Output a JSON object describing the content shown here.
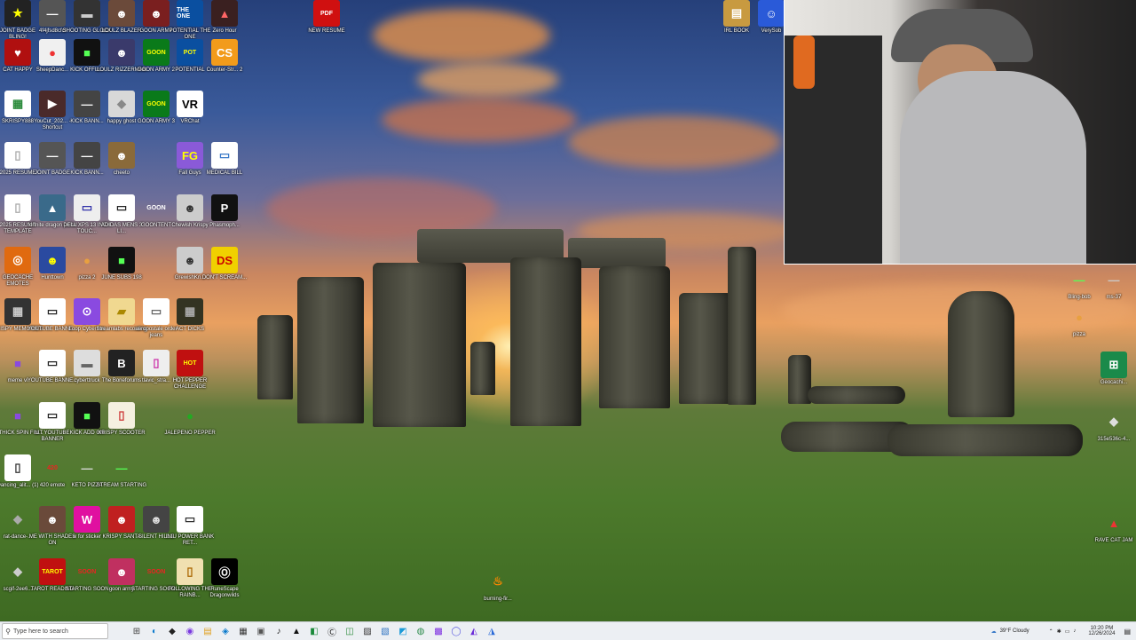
{
  "desktop_icons": [
    {
      "label": "JOINT BADGE BLING!",
      "glyph": "★",
      "bg": "#222",
      "fg": "#ff0"
    },
    {
      "label": "4f4jfsd8cfcl",
      "glyph": "—",
      "bg": "#555",
      "fg": "#fff"
    },
    {
      "label": "SHOOTING GLOCK",
      "glyph": "▬",
      "bg": "#333",
      "fg": "#ccc"
    },
    {
      "label": "LOULZ BLAZER",
      "glyph": "☻",
      "bg": "#6b4a3a",
      "fg": "#fff"
    },
    {
      "label": "GOON ARMY",
      "glyph": "☻",
      "bg": "#7a1f1f",
      "fg": "#fff"
    },
    {
      "label": "POTENTIAL THE ONE",
      "glyph": "THE ONE",
      "bg": "#0a4fa0",
      "fg": "#fff"
    },
    {
      "label": "Zero Hour",
      "glyph": "▲",
      "bg": "#3a2020",
      "fg": "#f66"
    },
    {
      "label": "CAT HAPPY",
      "glyph": "♥",
      "bg": "#b01010",
      "fg": "#fff"
    },
    {
      "label": "SheepDanc...",
      "glyph": "●",
      "bg": "#f0f0f0",
      "fg": "#e33"
    },
    {
      "label": "KICK OFFLI...",
      "glyph": "■",
      "bg": "#111",
      "fg": "#5f5"
    },
    {
      "label": "LOULZ RIZZERMAN",
      "glyph": "☻",
      "bg": "#3a3a6b",
      "fg": "#fff"
    },
    {
      "label": "GOON ARMY 2",
      "glyph": "GOON",
      "bg": "#0a7a1a",
      "fg": "#ff0"
    },
    {
      "label": "POTENTIAL",
      "glyph": "POT",
      "bg": "#0a4fa0",
      "fg": "#ff0"
    },
    {
      "label": "Counter-Str... 2",
      "glyph": "CS",
      "bg": "#f29b1b",
      "fg": "#fff"
    },
    {
      "label": "SKRISPY888",
      "glyph": "▦",
      "bg": "#fff",
      "fg": "#2a8a3a"
    },
    {
      "label": "YouCut_202... - Shortcut",
      "glyph": "▶",
      "bg": "#4a2a2a",
      "fg": "#fff"
    },
    {
      "label": "KICK BANN...",
      "glyph": "—",
      "bg": "#444",
      "fg": "#fff"
    },
    {
      "label": "happy ghost",
      "glyph": "◆",
      "bg": "#d8d8d8",
      "fg": "#888"
    },
    {
      "label": "GOON ARMY 3",
      "glyph": "GOON",
      "bg": "#0a7a1a",
      "fg": "#ff0"
    },
    {
      "label": "VRChat",
      "glyph": "VR",
      "bg": "#fff",
      "fg": "#000"
    },
    {
      "label": "2025 RESUME",
      "glyph": "▯",
      "bg": "#fff",
      "fg": "#aaa"
    },
    {
      "label": "JOINT BADGE",
      "glyph": "—",
      "bg": "#555",
      "fg": "#fff"
    },
    {
      "label": "KICK BANN...",
      "glyph": "—",
      "bg": "#444",
      "fg": "#fff"
    },
    {
      "label": "cheeto",
      "glyph": "☻",
      "bg": "#8a6a3a",
      "fg": "#fff"
    },
    {
      "label": "Fall Guys",
      "glyph": "FG",
      "bg": "#8a5ad8",
      "fg": "#ff0"
    },
    {
      "label": "MEDICAL BILL",
      "glyph": "▭",
      "bg": "#fff",
      "fg": "#3a7ac8"
    },
    {
      "label": "2025 RESUME TEMPLATE",
      "glyph": "▯",
      "bg": "#fff",
      "fg": "#aaa"
    },
    {
      "label": "fortnite dragon portal",
      "glyph": "▲",
      "bg": "#3a6a8a",
      "fg": "#fff"
    },
    {
      "label": "DELL XPS 13 INCH TOUC...",
      "glyph": "▭",
      "bg": "#eee",
      "fg": "#33a"
    },
    {
      "label": "ADIDAS MENS 3 LI...",
      "glyph": "▭",
      "bg": "#fff",
      "fg": "#222"
    },
    {
      "label": "GOONTENT",
      "glyph": "GOON",
      "bg": "transparent",
      "fg": "#fff"
    },
    {
      "label": "Chewish Krispy",
      "glyph": "☻",
      "bg": "#ccc",
      "fg": "#333"
    },
    {
      "label": "Phasmoph...",
      "glyph": "P",
      "bg": "#111",
      "fg": "#fff"
    },
    {
      "label": "GEOCACHE EMOTES",
      "glyph": "◎",
      "bg": "#e06a10",
      "fg": "#fff"
    },
    {
      "label": "Hunttown",
      "glyph": "☻",
      "bg": "#2a4aa0",
      "fg": "#ff0"
    },
    {
      "label": "pizza 2",
      "glyph": "●",
      "bg": "transparent",
      "fg": "#e8a040"
    },
    {
      "label": "JUNE SUBS 198",
      "glyph": "■",
      "bg": "#111",
      "fg": "#5f5"
    },
    {
      "label": "GrewishKri...",
      "glyph": "☻",
      "bg": "#ccc",
      "fg": "#333"
    },
    {
      "label": "DON'T SCREAM...",
      "glyph": "DS",
      "bg": "#f0d000",
      "fg": "#c00"
    },
    {
      "label": "KRISPY MEMORIES",
      "glyph": "▦",
      "bg": "#333",
      "fg": "#ccc"
    },
    {
      "label": "YOUTUBE BANNE...",
      "glyph": "▭",
      "bg": "#fff",
      "fg": "#222"
    },
    {
      "label": "Loop Cyberimo",
      "glyph": "⊙",
      "bg": "#8a4ae0",
      "fg": "#fff"
    },
    {
      "label": "Streamlabs recording",
      "glyph": "▰",
      "bg": "#f0d890",
      "fg": "#a80"
    },
    {
      "label": "aeropostale order jeans",
      "glyph": "▭",
      "bg": "#fff",
      "fg": "#666"
    },
    {
      "label": "ACT DICKS",
      "glyph": "▦",
      "bg": "#332",
      "fg": "#aaa"
    },
    {
      "label": "meme vi",
      "glyph": "■",
      "bg": "transparent",
      "fg": "#8a4ae0"
    },
    {
      "label": "YOUTUBE BANNE...",
      "glyph": "▭",
      "bg": "#fff",
      "fg": "#222"
    },
    {
      "label": "cyberttruck",
      "glyph": "▬",
      "bg": "#ddd",
      "fg": "#666"
    },
    {
      "label": "The Boneforums",
      "glyph": "B",
      "bg": "#222",
      "fg": "#fff"
    },
    {
      "label": "tlavic_stra...",
      "glyph": "▯",
      "bg": "#eee",
      "fg": "#c3a"
    },
    {
      "label": "HOT PEPPER CHALLENGE",
      "glyph": "HOT",
      "bg": "#c01010",
      "fg": "#ff0"
    },
    {
      "label": "W THICK SPIN FIN...",
      "glyph": "■",
      "bg": "transparent",
      "fg": "#8a4ae0"
    },
    {
      "label": "LIT YOUTUBE BANNER",
      "glyph": "▭",
      "bg": "#fff",
      "fg": "#222"
    },
    {
      "label": "KICK ADD ON",
      "glyph": "■",
      "bg": "#111",
      "fg": "#5f5"
    },
    {
      "label": "KRISPY SCOOTER",
      "glyph": "▯",
      "bg": "#f5f0e0",
      "fg": "#c33"
    },
    {
      "label": "JALEPENO PEPPER",
      "glyph": "●",
      "bg": "transparent",
      "fg": "#2a2"
    },
    {
      "label": "Dancing_alit... (1)",
      "glyph": "▯",
      "bg": "#fff",
      "fg": "#333"
    },
    {
      "label": "420 emote",
      "glyph": "420",
      "bg": "transparent",
      "fg": "#e22"
    },
    {
      "label": "KETO PIZZA",
      "glyph": "—",
      "bg": "transparent",
      "fg": "#ddd"
    },
    {
      "label": "STREAM STARTING",
      "glyph": "—",
      "bg": "transparent",
      "fg": "#5f5"
    },
    {
      "label": "rat-dance-...",
      "glyph": "◆",
      "bg": "transparent",
      "fg": "#aaa"
    },
    {
      "label": "ME WITH SHADES ON",
      "glyph": "☻",
      "bg": "#6a4a3a",
      "fg": "#fff"
    },
    {
      "label": "w for sticker",
      "glyph": "W",
      "bg": "#e010a0",
      "fg": "#fff"
    },
    {
      "label": "KRISPY SANTA",
      "glyph": "☻",
      "bg": "#c02020",
      "fg": "#fff"
    },
    {
      "label": "SILENT HILL 2",
      "glyph": "☻",
      "bg": "#444",
      "fg": "#ddd"
    },
    {
      "label": "INIU POWER BANK RET...",
      "glyph": "▭",
      "bg": "#fff",
      "fg": "#333"
    },
    {
      "label": "scgif-2ee6...",
      "glyph": "◆",
      "bg": "transparent",
      "fg": "#ccc"
    },
    {
      "label": "TAROT READING",
      "glyph": "TAROT",
      "bg": "#c01010",
      "fg": "#ff0"
    },
    {
      "label": "STARTING SOON",
      "glyph": "SOON",
      "bg": "transparent",
      "fg": "#e22"
    },
    {
      "label": "goon army",
      "glyph": "☻",
      "bg": "#c03060",
      "fg": "#fff"
    },
    {
      "label": "STARTING SOON ...",
      "glyph": "SOON",
      "bg": "transparent",
      "fg": "#e22"
    },
    {
      "label": "FOLLOWING THE RAINB...",
      "glyph": "▯",
      "bg": "#f0e0b0",
      "fg": "#a60"
    },
    {
      "label": "RuneScape Dragonwilds",
      "glyph": "Ⓞ",
      "bg": "#000",
      "fg": "#fff"
    }
  ],
  "other_icons": [
    {
      "label": "NEW RESUME",
      "glyph": "PDF",
      "bg": "#d01010",
      "fg": "#fff"
    },
    {
      "label": "IRL BOOK",
      "glyph": "▤",
      "bg": "#c89a40",
      "fg": "#fff"
    },
    {
      "label": "VerySob",
      "glyph": "☺",
      "bg": "#2a5ad8",
      "fg": "#fff"
    },
    {
      "label": "Bling-bob",
      "glyph": "—",
      "bg": "transparent",
      "fg": "#5f5"
    },
    {
      "label": "ms-37",
      "glyph": "—",
      "bg": "transparent",
      "fg": "#ccc"
    },
    {
      "label": "pizza",
      "glyph": "●",
      "bg": "transparent",
      "fg": "#e8a040"
    },
    {
      "label": "Geocachi...",
      "glyph": "⊞",
      "bg": "#1a8a4a",
      "fg": "#fff"
    },
    {
      "label": "315e536c-4...",
      "glyph": "◆",
      "bg": "transparent",
      "fg": "#ddd"
    },
    {
      "label": "RAVE CAT JAM",
      "glyph": "▲",
      "bg": "transparent",
      "fg": "#e33"
    },
    {
      "label": "burning-fir...",
      "glyph": "♨",
      "bg": "transparent",
      "fg": "#f80"
    }
  ],
  "taskbar": {
    "search_placeholder": "Type here to search",
    "apps": [
      "⊞",
      "◐",
      "◆",
      "◉",
      "▤",
      "◈",
      "▦",
      "▣",
      "♪",
      "▲",
      "◧",
      "Ⓒ",
      "◫",
      "▨",
      "▧",
      "◩",
      "◍",
      "▩",
      "◯",
      "◭",
      "◮"
    ],
    "weather": "39°F Cloudy",
    "time": "10:20 PM",
    "date": "12/26/2024"
  },
  "colors": {
    "taskbar_bg": "#eceff3",
    "accent": "#0067c0"
  }
}
